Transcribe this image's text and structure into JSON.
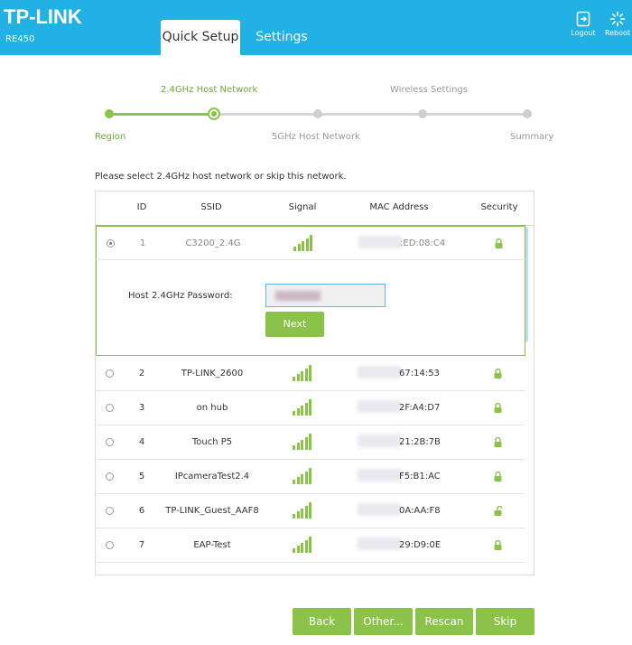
{
  "header": {
    "brand": "TP-LINK",
    "model": "RE450",
    "tabs": [
      {
        "label": "Quick Setup"
      },
      {
        "label": "Settings"
      }
    ],
    "logout_label": "Logout",
    "reboot_label": "Reboot",
    "bg_color": "#21b2e3"
  },
  "stepper": {
    "steps": [
      {
        "label": "Region",
        "state": "done"
      },
      {
        "label": "2.4GHz Host Network",
        "state": "current"
      },
      {
        "label": "5GHz Host Network",
        "state": "pending"
      },
      {
        "label": "Wireless Settings",
        "state": "pending"
      },
      {
        "label": "Summary",
        "state": "pending"
      }
    ],
    "accent": "#8bc34a"
  },
  "instruction": "Please select 2.4GHz host network or skip this network.",
  "table": {
    "columns": [
      "ID",
      "SSID",
      "Signal",
      "MAC Address",
      "Security"
    ],
    "rows": [
      {
        "id": "1",
        "ssid": "C3200_2.4G",
        "mac": ":ED:08:C4",
        "selected": true,
        "signal_bars": 5,
        "lock": "locked"
      },
      {
        "id": "2",
        "ssid": "TP-LINK_2600",
        "mac": "67:14:53",
        "selected": false,
        "signal_bars": 5,
        "lock": "locked"
      },
      {
        "id": "3",
        "ssid": "on hub",
        "mac": "2F:A4:D7",
        "selected": false,
        "signal_bars": 5,
        "lock": "locked"
      },
      {
        "id": "4",
        "ssid": "Touch P5",
        "mac": "21:2B:7B",
        "selected": false,
        "signal_bars": 5,
        "lock": "locked"
      },
      {
        "id": "5",
        "ssid": "IPcameraTest2.4",
        "mac": "F5:B1:AC",
        "selected": false,
        "signal_bars": 5,
        "lock": "locked"
      },
      {
        "id": "6",
        "ssid": "TP-LINK_Guest_AAF8",
        "mac": "0A:AA:F8",
        "selected": false,
        "signal_bars": 5,
        "lock": "unlocked"
      },
      {
        "id": "7",
        "ssid": "EAP-Test",
        "mac": "29:D9:0E",
        "selected": false,
        "signal_bars": 5,
        "lock": "locked"
      }
    ],
    "password_label": "Host 2.4GHz Password:",
    "next_label": "Next"
  },
  "buttons": {
    "back": "Back",
    "other": "Other...",
    "rescan": "Rescan",
    "skip": "Skip"
  }
}
